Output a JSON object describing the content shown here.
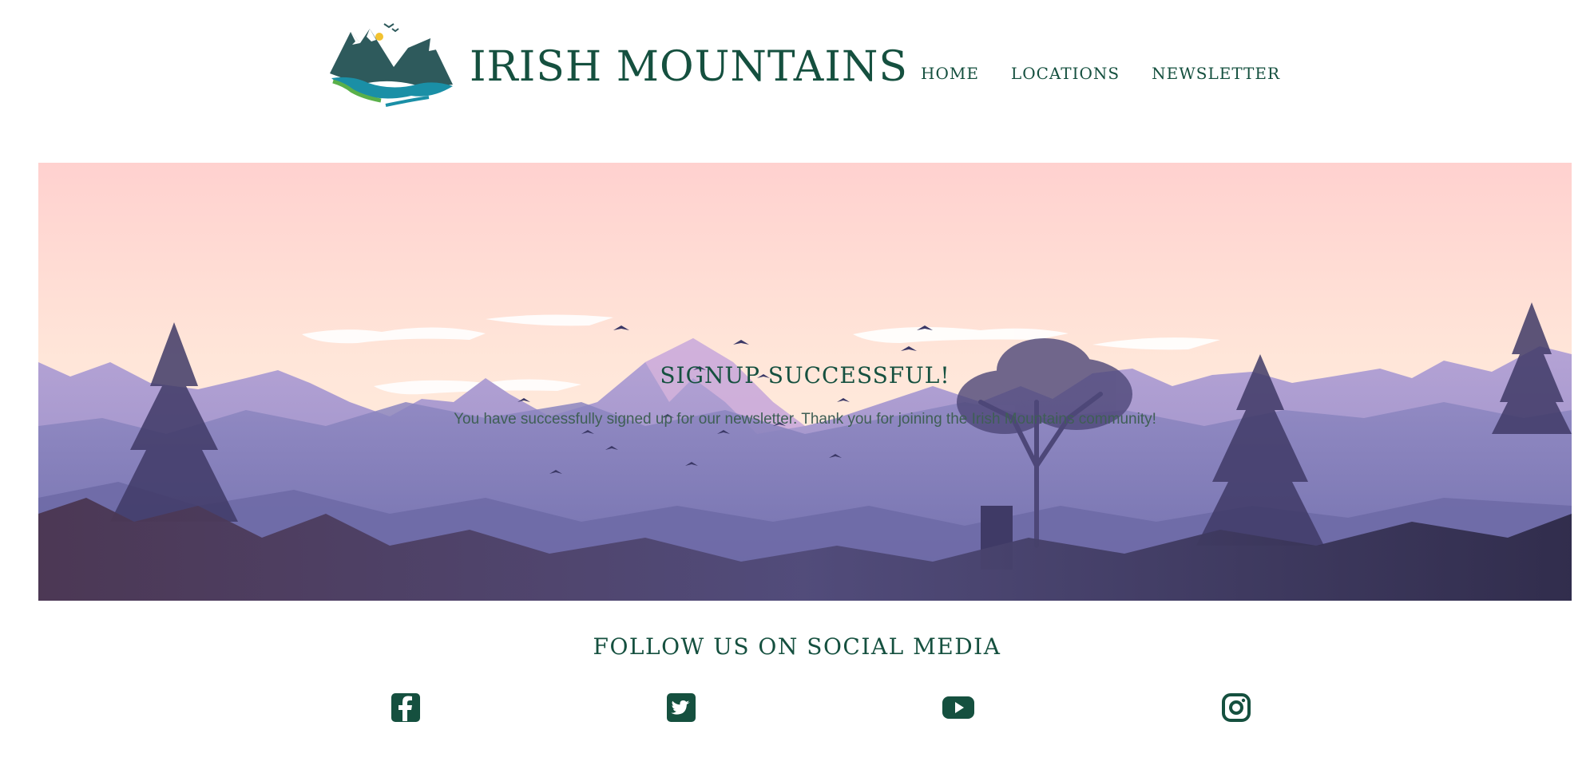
{
  "brand": {
    "name": "IRISH MOUNTAINS",
    "logo_icon": "mountain-lake-logo"
  },
  "nav": {
    "items": [
      {
        "label": "HOME"
      },
      {
        "label": "LOCATIONS"
      },
      {
        "label": "NEWSLETTER"
      }
    ]
  },
  "hero": {
    "title": "SIGNUP SUCCESSFUL!",
    "message": "You have successfully signed up for our newsletter. Thank you for joining the Irish Mountains community!"
  },
  "social": {
    "title": "FOLLOW US ON SOCIAL MEDIA",
    "icons": [
      "facebook-icon",
      "twitter-icon",
      "youtube-icon",
      "instagram-icon"
    ]
  },
  "colors": {
    "brand_green": "#15503f",
    "sky_top": "#ffd3d1",
    "mountain_purple": "#9b8fc7"
  }
}
